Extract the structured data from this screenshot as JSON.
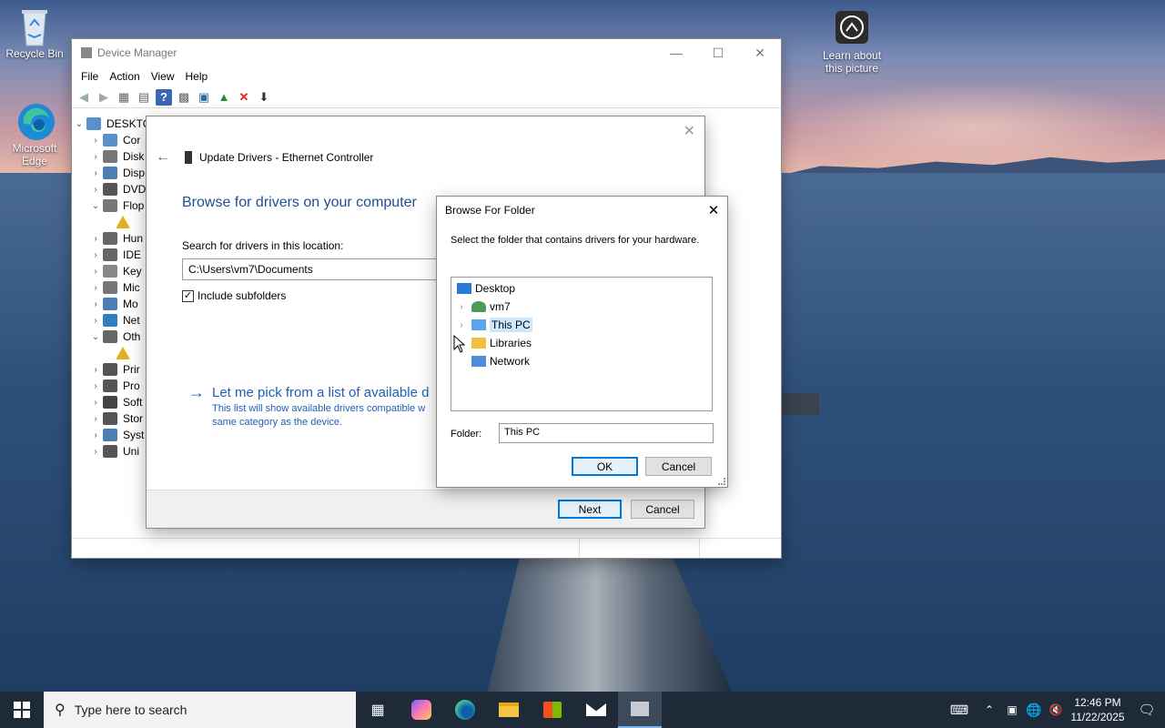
{
  "desktop": {
    "icons": [
      {
        "label": "Recycle Bin"
      },
      {
        "label": "Microsoft Edge"
      },
      {
        "label": "Learn about this picture"
      }
    ]
  },
  "device_manager": {
    "title": "Device Manager",
    "menu": [
      "File",
      "Action",
      "View",
      "Help"
    ],
    "root_label": "DESKTO",
    "tree": [
      {
        "label": "Cor",
        "icon": "computer-icon"
      },
      {
        "label": "Disk",
        "icon": "disk-icon"
      },
      {
        "label": "Disp",
        "icon": "display-icon"
      },
      {
        "label": "DVD",
        "icon": "dvd-icon"
      },
      {
        "label": "Flop",
        "icon": "floppy-icon"
      },
      {
        "label": "",
        "icon": "warning-device-icon"
      },
      {
        "label": "Hun",
        "icon": "hid-icon"
      },
      {
        "label": "IDE",
        "icon": "ide-icon"
      },
      {
        "label": "Key",
        "icon": "keyboard-icon"
      },
      {
        "label": "Mic",
        "icon": "mouse-icon"
      },
      {
        "label": "Mo",
        "icon": "monitor-icon"
      },
      {
        "label": "Net",
        "icon": "network-icon"
      },
      {
        "label": "Oth",
        "icon": "other-devices-icon"
      },
      {
        "label": "",
        "icon": "warning-device-icon"
      },
      {
        "label": "Prir",
        "icon": "printer-icon"
      },
      {
        "label": "Pro",
        "icon": "processor-icon"
      },
      {
        "label": "Soft",
        "icon": "software-icon"
      },
      {
        "label": "Stor",
        "icon": "storage-icon"
      },
      {
        "label": "Syst",
        "icon": "system-icon"
      },
      {
        "label": "Uni",
        "icon": "usb-icon"
      }
    ]
  },
  "update_drivers": {
    "title": "Update Drivers - Ethernet Controller",
    "heading": "Browse for drivers on your computer",
    "search_label": "Search for drivers in this location:",
    "path_value": "C:\\Users\\vm7\\Documents",
    "include_subfolders": "Include subfolders",
    "pick_link": "Let me pick from a list of available d",
    "pick_desc_1": "This list will show available drivers compatible w",
    "pick_desc_2": "same category as the device.",
    "next": "Next",
    "cancel": "Cancel"
  },
  "browse_folder": {
    "title": "Browse For Folder",
    "instruction": "Select the folder that contains drivers for your hardware.",
    "tree": [
      {
        "label": "Desktop",
        "icon": "desktop-folder-icon",
        "indent": 0,
        "expander": false
      },
      {
        "label": "vm7",
        "icon": "user-folder-icon",
        "indent": 1,
        "expander": true
      },
      {
        "label": "This PC",
        "icon": "this-pc-icon",
        "indent": 1,
        "expander": true,
        "selected": true
      },
      {
        "label": "Libraries",
        "icon": "libraries-icon",
        "indent": 1,
        "expander": true
      },
      {
        "label": "Network",
        "icon": "network-icon",
        "indent": 1,
        "expander": false
      }
    ],
    "folder_label": "Folder:",
    "folder_value": "This PC",
    "ok": "OK",
    "cancel": "Cancel"
  },
  "taskbar": {
    "search_placeholder": "Type here to search",
    "time": "12:46 PM",
    "date": "11/22/2025"
  }
}
